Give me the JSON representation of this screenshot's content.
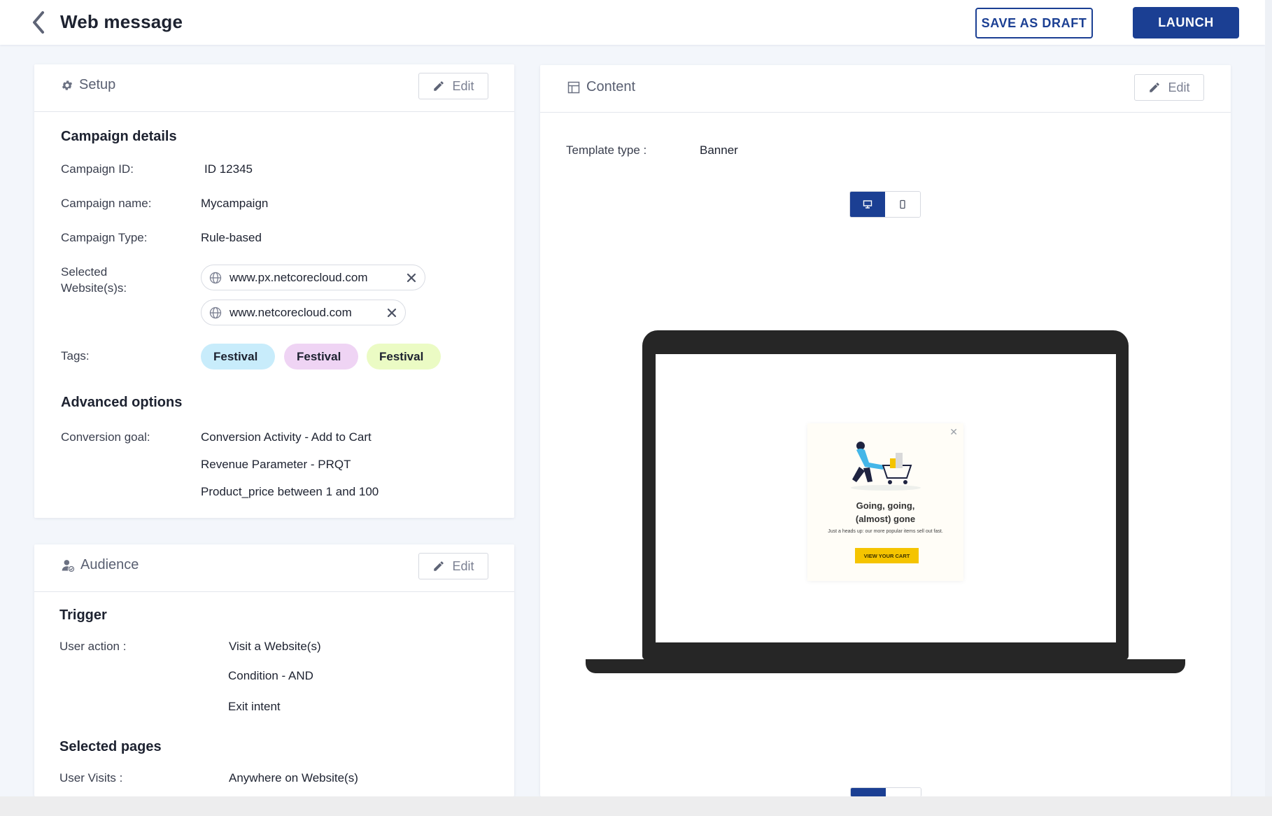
{
  "header": {
    "title": "Web message",
    "save_draft_label": "SAVE AS DRAFT",
    "launch_label": "LAUNCH"
  },
  "setup": {
    "title": "Setup",
    "edit_label": "Edit",
    "campaign_details_heading": "Campaign details",
    "campaign_id_label": "Campaign ID:",
    "campaign_id_value": "ID 12345",
    "campaign_name_label": "Campaign name:",
    "campaign_name_value": "Mycampaign",
    "campaign_type_label": "Campaign Type:",
    "campaign_type_value": "Rule-based",
    "websites_label_line1": "Selected",
    "websites_label_line2": "Website(s)s:",
    "websites": [
      "www.px.netcorecloud.com",
      "www.netcorecloud.com"
    ],
    "tags_label": "Tags:",
    "tags": [
      {
        "label": "Festival",
        "color": "#c8ecfb"
      },
      {
        "label": "Festival",
        "color": "#efd4f4"
      },
      {
        "label": "Festival",
        "color": "#ebfbc4"
      }
    ],
    "advanced_heading": "Advanced options",
    "conversion_goal_label": "Conversion goal:",
    "conversion_goals": [
      "Conversion Activity - Add to Cart",
      "Revenue Parameter - PRQT",
      "Product_price between 1 and 100"
    ]
  },
  "audience": {
    "title": "Audience",
    "edit_label": "Edit",
    "trigger_heading": "Trigger",
    "user_action_label": "User action :",
    "user_actions": [
      "Visit a Website(s)",
      "Condition - AND",
      "Exit intent"
    ],
    "selected_pages_heading": "Selected pages",
    "user_visits_label": "User Visits :",
    "user_visits_value": "Anywhere on Website(s)"
  },
  "content": {
    "title": "Content",
    "edit_label": "Edit",
    "template_type_label": "Template type :",
    "template_type_value": "Banner",
    "device_options": [
      "desktop-icon",
      "mobile-icon"
    ],
    "active_device": "desktop",
    "preview": {
      "headline_line1": "Going, going,",
      "headline_line2": "(almost) gone",
      "subtext": "Just a heads up: our more popular items sell out fast.",
      "cta_label": "VIEW YOUR CART"
    }
  },
  "colors": {
    "primary": "#1b3f93",
    "background": "#f3f6fb",
    "cta_yellow": "#f5c400"
  }
}
